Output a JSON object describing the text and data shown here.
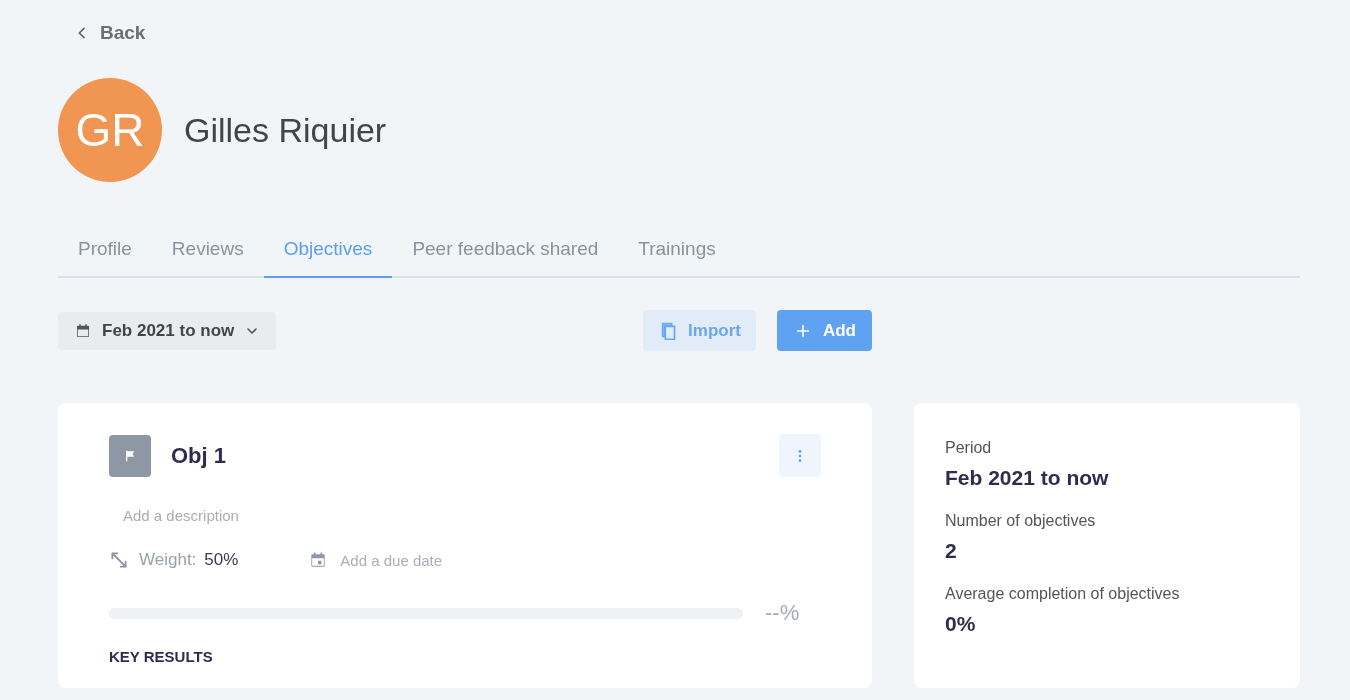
{
  "back": {
    "label": "Back"
  },
  "profile": {
    "initials": "GR",
    "name": "Gilles Riquier"
  },
  "tabs": [
    {
      "label": "Profile",
      "selected": false
    },
    {
      "label": "Reviews",
      "selected": false
    },
    {
      "label": "Objectives",
      "selected": true
    },
    {
      "label": "Peer feedback shared",
      "selected": false
    },
    {
      "label": "Trainings",
      "selected": false
    }
  ],
  "toolbar": {
    "period": "Feb 2021 to now",
    "import": "Import",
    "add": "Add"
  },
  "objective": {
    "title": "Obj 1",
    "description": {
      "placeholder": "Add a description"
    },
    "weight_label": "Weight:",
    "weight": "50%",
    "due_date": {
      "placeholder": "Add a due date"
    },
    "progress": {
      "level": 0,
      "reading": "--%"
    },
    "section": "KEY RESULTS"
  },
  "summary": [
    {
      "label": "Period",
      "value": "Feb 2021 to now"
    },
    {
      "label": "Number of objectives",
      "value": "2"
    },
    {
      "label": "Average completion of objectives",
      "value": "0%"
    }
  ]
}
